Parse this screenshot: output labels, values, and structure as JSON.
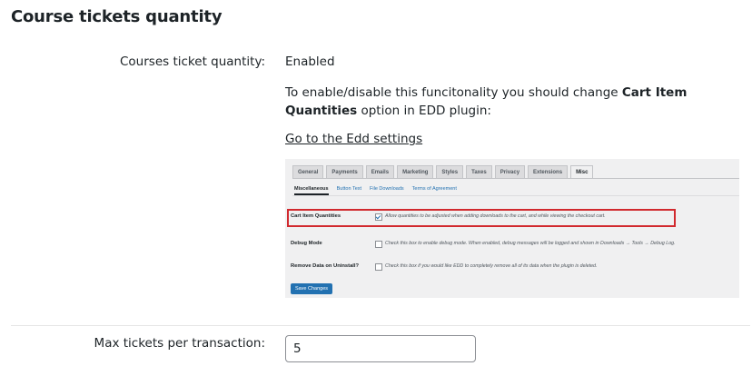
{
  "page": {
    "title": "Course tickets quantity"
  },
  "setting1": {
    "label": "Courses ticket quantity:",
    "status": "Enabled",
    "desc_prefix": "To enable/disable this funcitonality you should change ",
    "desc_bold": "Cart Item Quantities",
    "desc_suffix": " option in EDD plugin:",
    "link": "Go to the Edd settings"
  },
  "screenshot": {
    "tabs": [
      "General",
      "Payments",
      "Emails",
      "Marketing",
      "Styles",
      "Taxes",
      "Privacy",
      "Extensions",
      "Misc"
    ],
    "active_tab": "Misc",
    "subnav": [
      "Miscellaneous",
      "Button Text",
      "File Downloads",
      "Terms of Agreement"
    ],
    "rows": [
      {
        "label": "Cart Item Quantities",
        "checked": true,
        "desc": "Allow quantities to be adjusted when adding downloads to the cart, and while viewing the checkout cart."
      },
      {
        "label": "Debug Mode",
        "checked": false,
        "desc": "Check this box to enable debug mode. When enabled, debug messages will be logged and shown in Downloads → Tools → Debug Log."
      },
      {
        "label": "Remove Data on Uninstall?",
        "checked": false,
        "desc": "Check this box if you would like EDD to completely remove all of its data when the plugin is deleted."
      }
    ],
    "save_label": "Save Changes",
    "highlight_color": "#d1292e"
  },
  "setting2": {
    "label": "Max tickets per transaction:",
    "value": "5"
  }
}
